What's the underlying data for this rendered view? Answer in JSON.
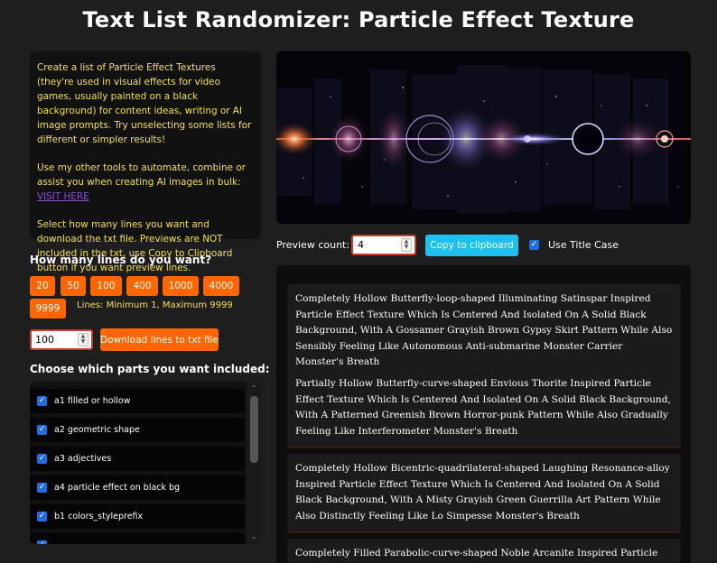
{
  "page": {
    "title": "Text List Randomizer: Particle Effect Texture"
  },
  "intro": {
    "paragraph1": "Create a list of Particle Effect Textures (they're used in visual effects for video games, usually painted on a black background) for content ideas, writing or AI image prompts. Try unselecting some lists for different or simpler results!",
    "paragraph2_prefix": "Use my other tools to automate, combine or assist you when creating AI images in bulk: ",
    "paragraph2_link": "VISIT HERE",
    "paragraph3": "Select how many lines you want and download the txt file. Previews are NOT included in the txt, use Copy to Clipboard button if you want preview lines."
  },
  "lines": {
    "label": "How many lines do you want?",
    "presets": [
      "20",
      "50",
      "100",
      "400",
      "1000",
      "4000",
      "9999"
    ],
    "limits": "Lines: Minimum 1, Maximum 9999",
    "value": "100",
    "download_label": "Download lines to txt file"
  },
  "parts": {
    "label": "Choose which parts you want included:",
    "items": [
      {
        "label": "a1 filled or hollow",
        "checked": true
      },
      {
        "label": "a2 geometric shape",
        "checked": true
      },
      {
        "label": "a3 adjectives",
        "checked": true
      },
      {
        "label": "a4 particle effect on black bg",
        "checked": true
      },
      {
        "label": "b1 colors_styleprefix",
        "checked": true
      },
      {
        "label": "",
        "checked": true
      }
    ]
  },
  "preview": {
    "label": "Preview count:",
    "value": "4",
    "copy_label": "Copy to clipboard",
    "title_case_label": "Use Title Case",
    "title_case_checked": true
  },
  "results": [
    "Completely Hollow Butterfly-loop-shaped Illuminating Satinspar Inspired Particle Effect Texture Which Is Centered And Isolated On A Solid Black Background, With A Gossamer Grayish Brown Gypsy Skirt Pattern While Also Sensibly Feeling Like Autonomous Anti-submarine Monster Carrier Monster's Breath",
    "Partially Hollow Butterfly-curve-shaped Envious Thorite Inspired Particle Effect Texture Which Is Centered And Isolated On A Solid Black Background, With A Patterned Greenish Brown Horror-punk Pattern While Also Gradually Feeling Like Interferometer Monster's Breath",
    "Completely Hollow Bicentric-quadrilateral-shaped Laughing Resonance-alloy Inspired Particle Effect Texture Which Is Centered And Isolated On A Solid Black Background, With A Misty Grayish Green Guerrilla Art Pattern While Also Distinctly Feeling Like Lo Simpesse Monster's Breath",
    "Completely Filled Parabolic-curve-shaped Noble Arcanite Inspired Particle Effect"
  ],
  "colors": {
    "background": "#1e1e1e",
    "intro_text": "#f2e14c",
    "link": "#8e4fd6",
    "orange_button": "#ff6600",
    "copy_button": "#1fbfef",
    "checkbox": "#1f6fe0",
    "input_border": "#cc3b2c"
  },
  "icons": {
    "hero": "particle-effect-strip-image",
    "spinner": "number-stepper-icon",
    "checkbox": "checkmark-icon",
    "scroll_up": "scroll-up-arrow-icon",
    "scroll_down": "scroll-down-arrow-icon"
  }
}
